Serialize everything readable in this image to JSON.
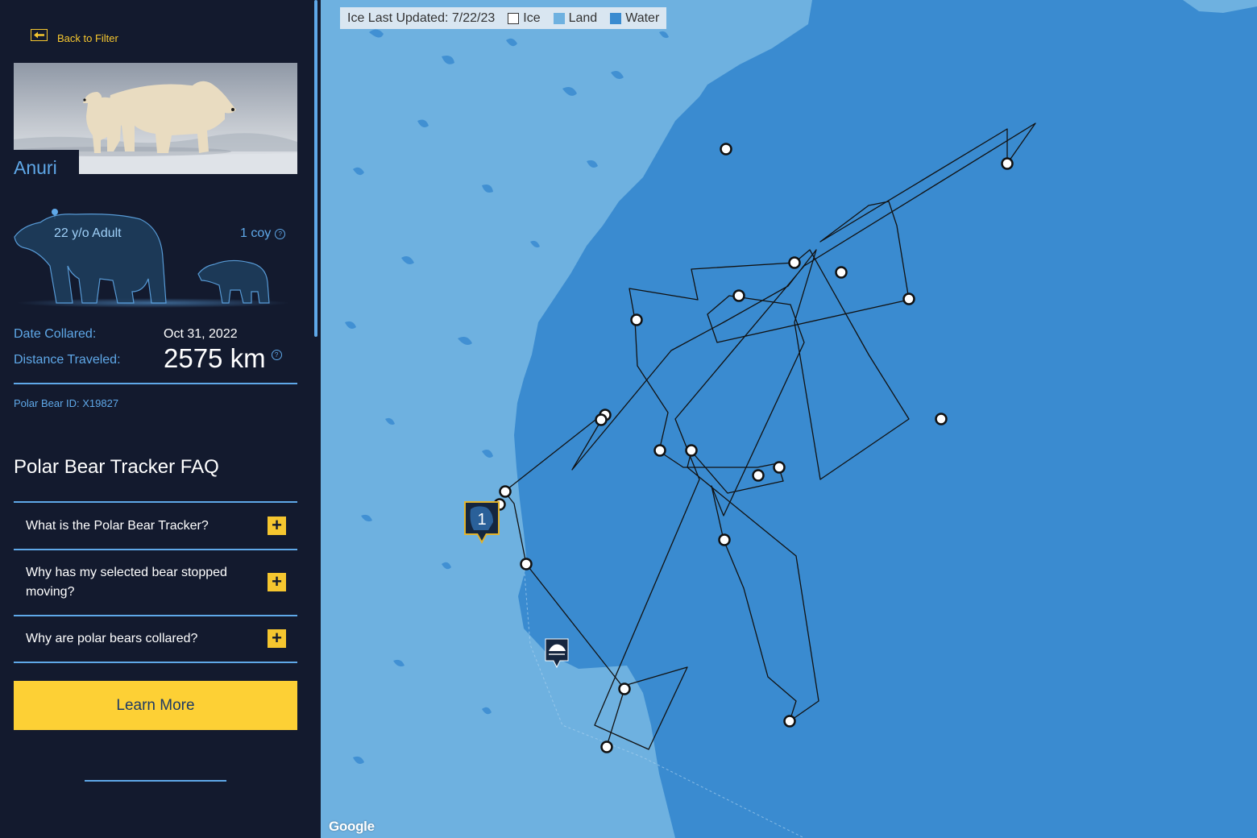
{
  "colors": {
    "sidebar": "#131a2e",
    "accent": "#5fa8e8",
    "yellow": "#fdd035",
    "land": "#6eb1e0",
    "water": "#3a8bd0",
    "ice": "#ffffff"
  },
  "sidebar": {
    "back_label": "Back to Filter",
    "bear_name": "Anuri",
    "age_label": "22 y/o Adult",
    "coy_label": "1 coy",
    "date_collared_label": "Date Collared:",
    "date_collared_value": "Oct 31, 2022",
    "distance_label": "Distance Traveled:",
    "distance_value": "2575 km",
    "bear_id": "Polar Bear ID: X19827",
    "faq_title": "Polar Bear Tracker FAQ",
    "faq": [
      {
        "question": "What is the Polar Bear Tracker?"
      },
      {
        "question": "Why has my selected bear stopped moving?"
      },
      {
        "question": "Why are polar bears collared?"
      }
    ],
    "learn_more_label": "Learn More"
  },
  "map": {
    "legend_updated": "Ice Last Updated: 7/22/23",
    "legend_items": [
      {
        "label": "Ice",
        "color": "#ffffff"
      },
      {
        "label": "Land",
        "color": "#6eb1e0"
      },
      {
        "label": "Water",
        "color": "#3a8bd0"
      }
    ],
    "marker_label": "1",
    "attribution": "Google",
    "icons": [
      "bear-marker-icon",
      "research-station-marker-icon",
      "track-point-icon"
    ]
  }
}
